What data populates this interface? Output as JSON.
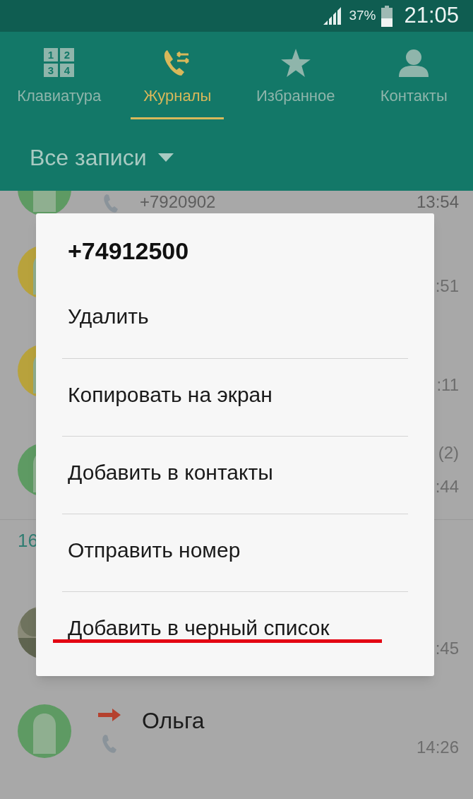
{
  "status_bar": {
    "battery": "37%",
    "time": "21:05"
  },
  "tabs": [
    {
      "label": "Клавиатура",
      "kind": "keypad",
      "digits": [
        "1",
        "2",
        "3",
        "4"
      ],
      "selected": false
    },
    {
      "label": "Журналы",
      "kind": "log",
      "selected": true
    },
    {
      "label": "Избранное",
      "kind": "star",
      "selected": false
    },
    {
      "label": "Контакты",
      "kind": "person",
      "selected": false
    }
  ],
  "filter": {
    "label": "Все записи"
  },
  "log": [
    {
      "kind": "default",
      "color": "#5e9a63",
      "number": "+7920902",
      "time": "13:54"
    },
    {
      "kind": "default",
      "color": "#b8a23c",
      "time": ":51"
    },
    {
      "kind": "default",
      "color": "#b8a23c",
      "time": ":11"
    },
    {
      "kind": "default",
      "color": "#5e9a63",
      "count": "(2)",
      "time": ":44"
    }
  ],
  "section": {
    "label": "16",
    "rows": [
      {
        "time": ":45"
      },
      {
        "kind": "default",
        "color": "#5e9a63",
        "name": "Ольга",
        "outgoing": true,
        "time": "14:26"
      }
    ]
  },
  "dialog": {
    "title": "+74912500",
    "items": [
      {
        "label": "Удалить",
        "highlighted": false
      },
      {
        "label": "Копировать на экран",
        "highlighted": false
      },
      {
        "label": "Добавить в контакты",
        "highlighted": false
      },
      {
        "label": "Отправить номер",
        "highlighted": false
      },
      {
        "label": "Добавить в черный список",
        "highlighted": true
      }
    ]
  }
}
